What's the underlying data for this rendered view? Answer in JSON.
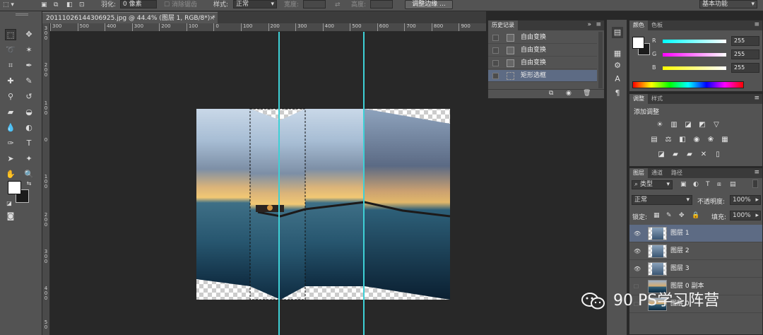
{
  "options_bar": {
    "feather_label": "羽化:",
    "feather_value": "0 像素",
    "antialias_label": "消除锯齿",
    "style_label": "样式:",
    "style_value": "正常",
    "width_label": "宽度:",
    "height_label": "高度:",
    "refine_edge_button": "调整边缘 ...",
    "workspace": "基本功能"
  },
  "document": {
    "tab_title": "20111026144306925.jpg @ 44.4% (图层 1, RGB/8*) *",
    "ruler_ticks": [
      "300",
      "500",
      "400",
      "300",
      "200",
      "100",
      "0",
      "100",
      "200",
      "300",
      "400",
      "500",
      "600",
      "700",
      "800",
      "900"
    ]
  },
  "history": {
    "tab": "历史记录",
    "items": [
      {
        "label": "自由变换"
      },
      {
        "label": "自由变换"
      },
      {
        "label": "自由变换"
      },
      {
        "label": "矩形选框"
      }
    ]
  },
  "color_panel": {
    "tabs": [
      "颜色",
      "色板"
    ],
    "channels": [
      {
        "name": "R",
        "value": "255"
      },
      {
        "name": "G",
        "value": "255"
      },
      {
        "name": "B",
        "value": "255"
      }
    ]
  },
  "adjustments": {
    "tabs": [
      "调整",
      "样式"
    ],
    "title": "添加调整"
  },
  "layers": {
    "tabs": [
      "图层",
      "通道",
      "路径"
    ],
    "filter_value": "类型",
    "blend_mode": "正常",
    "opacity_label": "不透明度:",
    "opacity_value": "100%",
    "lock_label": "锁定:",
    "fill_label": "填充:",
    "fill_value": "100%",
    "items": [
      {
        "name": "图层 1"
      },
      {
        "name": "图层 2"
      },
      {
        "name": "图层 3"
      },
      {
        "name": "图层 0 副本"
      },
      {
        "name": "图层 0"
      }
    ]
  },
  "watermark": {
    "text": "90 PS学习阵营"
  },
  "colors": {
    "ui_bg": "#535353",
    "canvas_bg": "#282828",
    "guide": "#3ed0d6",
    "selection": "#5d6b84"
  }
}
